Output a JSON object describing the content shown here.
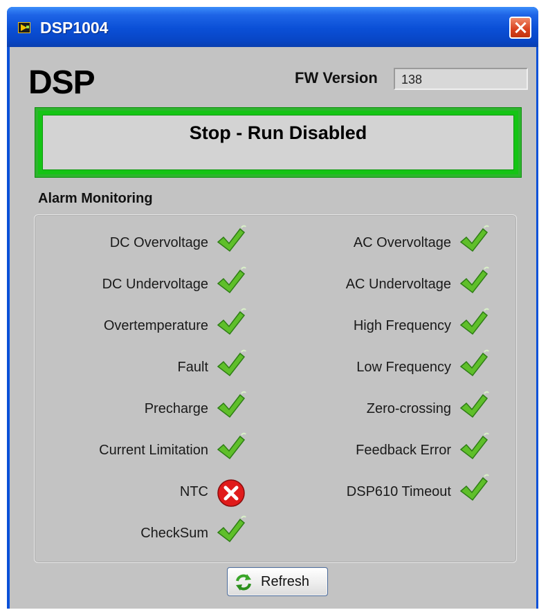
{
  "window": {
    "title": "DSP1004",
    "close_icon": "close-icon"
  },
  "header": {
    "title": "DSP",
    "fw_label": "FW Version",
    "fw_value": "138"
  },
  "status": {
    "text": "Stop - Run Disabled",
    "indicator_color": "#15c415"
  },
  "alarms": {
    "heading": "Alarm Monitoring",
    "left": [
      {
        "label": "DC Overvoltage",
        "status": "ok"
      },
      {
        "label": "DC Undervoltage",
        "status": "ok"
      },
      {
        "label": "Overtemperature",
        "status": "ok"
      },
      {
        "label": "Fault",
        "status": "ok"
      },
      {
        "label": "Precharge",
        "status": "ok"
      },
      {
        "label": "Current Limitation",
        "status": "ok"
      },
      {
        "label": "NTC",
        "status": "error"
      },
      {
        "label": "CheckSum",
        "status": "ok"
      }
    ],
    "right": [
      {
        "label": "AC Overvoltage",
        "status": "ok"
      },
      {
        "label": "AC Undervoltage",
        "status": "ok"
      },
      {
        "label": "High Frequency",
        "status": "ok"
      },
      {
        "label": "Low Frequency",
        "status": "ok"
      },
      {
        "label": "Zero-crossing",
        "status": "ok"
      },
      {
        "label": "Feedback Error",
        "status": "ok"
      },
      {
        "label": "DSP610 Timeout",
        "status": "ok"
      }
    ],
    "ok_color": "#5fbf2a",
    "error_color": "#e01b1b"
  },
  "actions": {
    "refresh_label": "Refresh",
    "refresh_icon": "refresh-icon"
  }
}
